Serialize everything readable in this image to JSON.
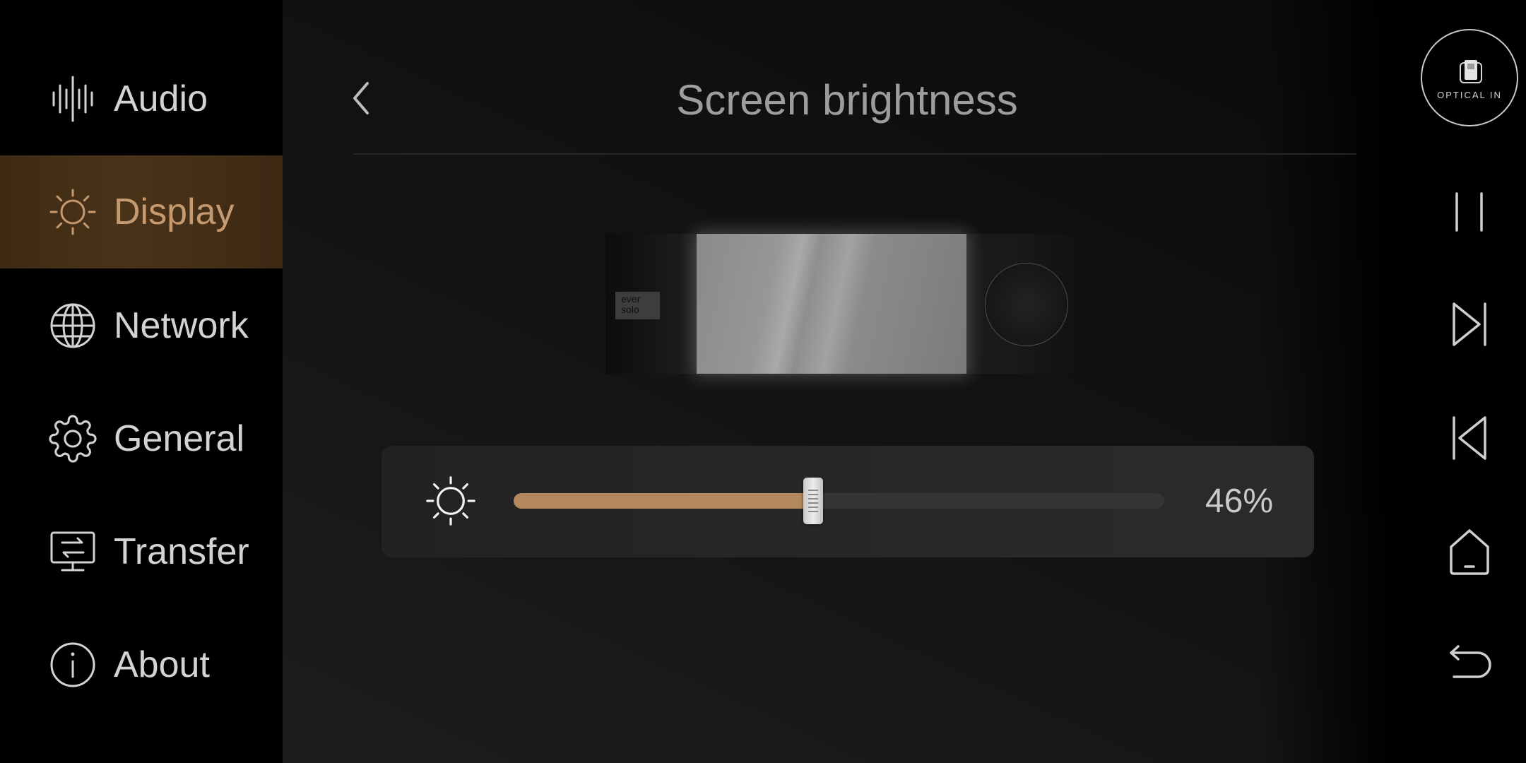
{
  "sidebar": {
    "items": [
      {
        "label": "Audio",
        "icon": "audio-waveform-icon",
        "selected": false
      },
      {
        "label": "Display",
        "icon": "sun-icon",
        "selected": true
      },
      {
        "label": "Network",
        "icon": "globe-icon",
        "selected": false
      },
      {
        "label": "General",
        "icon": "gear-icon",
        "selected": false
      },
      {
        "label": "Transfer",
        "icon": "transfer-monitor-icon",
        "selected": false
      },
      {
        "label": "About",
        "icon": "info-icon",
        "selected": false
      }
    ]
  },
  "header": {
    "title": "Screen brightness",
    "back_icon": "chevron-left-icon"
  },
  "device_preview": {
    "logo_text": "ever solo"
  },
  "brightness": {
    "icon": "sun-icon",
    "value": 46,
    "value_label": "46%"
  },
  "player": {
    "source": {
      "label": "OPTICAL IN",
      "icon": "optical-input-icon"
    },
    "controls": [
      {
        "icon": "pause-icon"
      },
      {
        "icon": "skip-next-icon"
      },
      {
        "icon": "skip-previous-icon"
      },
      {
        "icon": "home-icon"
      },
      {
        "icon": "back-arrow-icon"
      }
    ]
  },
  "colors": {
    "accent": "#c59a70",
    "slider_fill": "#b3885f",
    "text": "#d3d3d3",
    "title": "#9d9d9d",
    "icon": "#cfcfcf"
  }
}
